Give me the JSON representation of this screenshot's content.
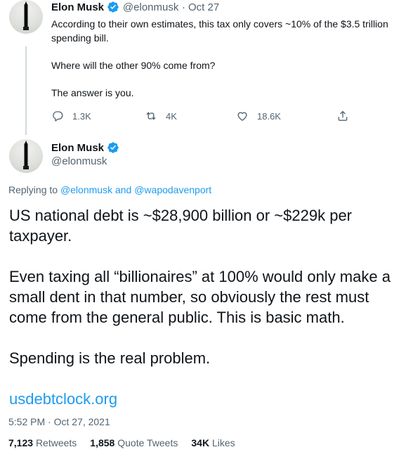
{
  "parent_tweet": {
    "author_name": "Elon Musk",
    "author_handle": "@elonmusk",
    "date": "· Oct 27",
    "paragraphs": [
      "According to their own estimates, this tax only covers ~10% of the $3.5 trillion spending bill.",
      "Where will the other 90% come from?",
      "The answer is you."
    ],
    "actions": {
      "replies": "1.3K",
      "retweets": "4K",
      "likes": "18.6K"
    }
  },
  "main_tweet": {
    "author_name": "Elon Musk",
    "author_handle": "@elonmusk",
    "replying_prefix": "Replying to",
    "replying_user1": "@elonmusk",
    "replying_and": "and",
    "replying_user2": "@wapodavenport",
    "paragraphs": [
      "US national debt is ~$28,900 billion or ~$229k per taxpayer.",
      "Even taxing all “billionaires” at 100% would only make a small dent in that number, so obviously the rest must come from the general public. This is basic math.",
      "Spending is the real problem."
    ],
    "link": "usdebtclock.org",
    "timestamp": "5:52 PM · Oct 27, 2021",
    "stats": {
      "retweets_count": "7,123",
      "retweets_label": "Retweets",
      "quotes_count": "1,858",
      "quotes_label": "Quote Tweets",
      "likes_count": "34K",
      "likes_label": "Likes"
    }
  },
  "icons": {
    "verified": "verified-badge-icon",
    "reply": "reply-icon",
    "retweet": "retweet-icon",
    "like": "heart-icon",
    "share": "share-icon"
  },
  "colors": {
    "accent": "#1d9bf0",
    "secondary_text": "#536471",
    "primary_text": "#0f1419"
  }
}
